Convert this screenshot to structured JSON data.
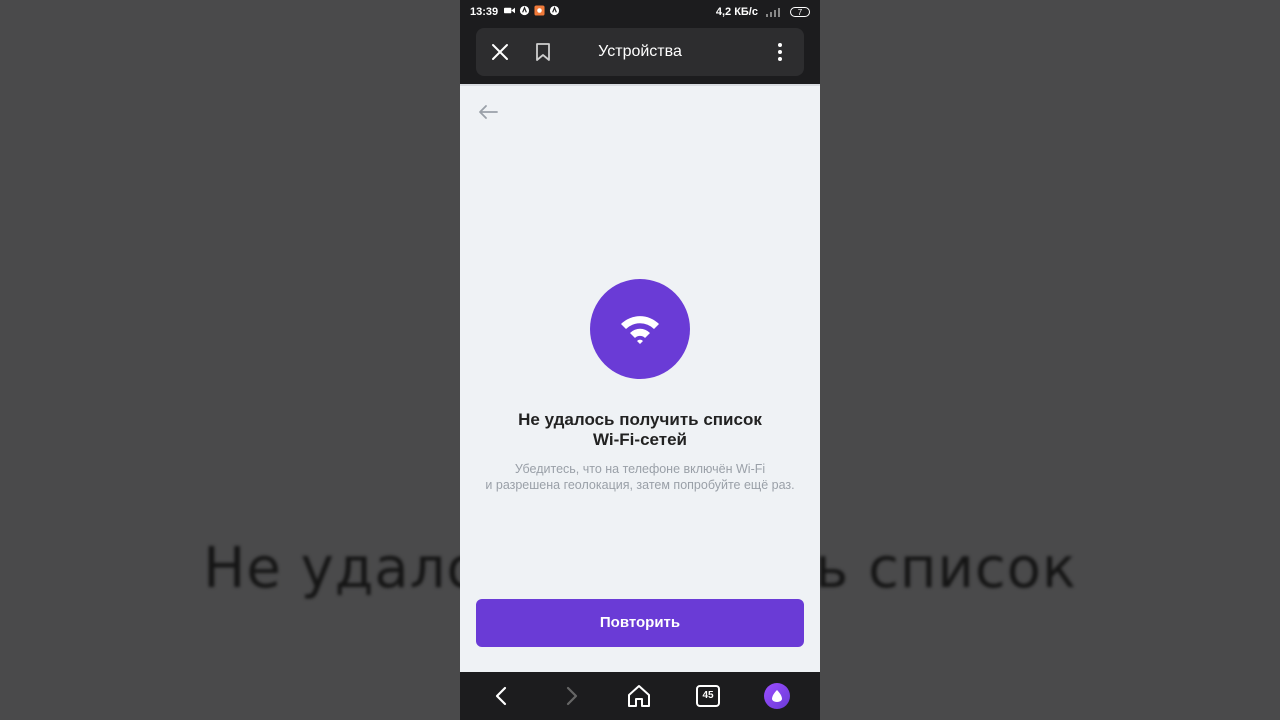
{
  "background": {
    "overlay_text": "Не удалось получить список"
  },
  "status_bar": {
    "time": "13:39",
    "speed": "4,2 КБ/с",
    "battery": "7"
  },
  "toolbar": {
    "title": "Устройства"
  },
  "content": {
    "title_line1": "Не удалось получить список",
    "title_line2": "Wi-Fi-сетей",
    "subtitle_line1": "Убедитесь, что на телефоне включён Wi-Fi",
    "subtitle_line2": "и разрешена геолокация, затем попробуйте ещё раз.",
    "retry_label": "Повторить"
  },
  "bottom_nav": {
    "tabs_count": "45"
  },
  "colors": {
    "accent": "#6a3bd6",
    "content_bg": "#eff2f5",
    "chrome_bg": "#1c1c1e"
  },
  "icons": [
    "close-icon",
    "bookmark-icon",
    "more-vertical-icon",
    "back-arrow-icon",
    "wifi-icon",
    "nav-back-icon",
    "nav-forward-icon",
    "home-icon",
    "tabs-icon",
    "alice-icon"
  ]
}
